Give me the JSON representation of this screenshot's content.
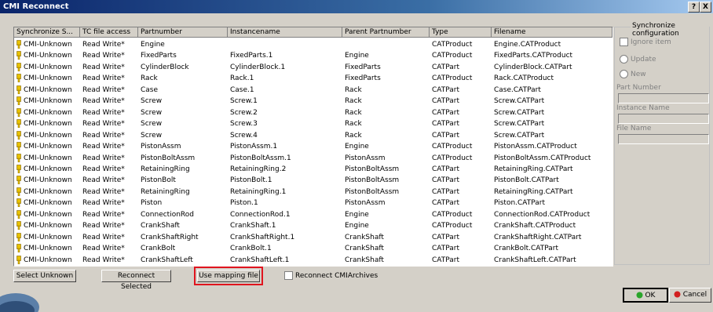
{
  "window": {
    "title": "CMI Reconnect",
    "help_label": "?",
    "close_label": "X"
  },
  "columns": [
    "Synchronize S...",
    "TC file access",
    "Partnumber",
    "Instancename",
    "Parent Partnumber",
    "Type",
    "Filename"
  ],
  "rows": [
    [
      "CMI-Unknown",
      "Read Write*",
      "Engine",
      "",
      "",
      "CATProduct",
      "Engine.CATProduct"
    ],
    [
      "CMI-Unknown",
      "Read Write*",
      "FixedParts",
      "FixedParts.1",
      "Engine",
      "CATProduct",
      "FixedParts.CATProduct"
    ],
    [
      "CMI-Unknown",
      "Read Write*",
      "CylinderBlock",
      "CylinderBlock.1",
      "FixedParts",
      "CATPart",
      "CylinderBlock.CATPart"
    ],
    [
      "CMI-Unknown",
      "Read Write*",
      "Rack",
      "Rack.1",
      "FixedParts",
      "CATProduct",
      "Rack.CATProduct"
    ],
    [
      "CMI-Unknown",
      "Read Write*",
      "Case",
      "Case.1",
      "Rack",
      "CATPart",
      "Case.CATPart"
    ],
    [
      "CMI-Unknown",
      "Read Write*",
      "Screw",
      "Screw.1",
      "Rack",
      "CATPart",
      "Screw.CATPart"
    ],
    [
      "CMI-Unknown",
      "Read Write*",
      "Screw",
      "Screw.2",
      "Rack",
      "CATPart",
      "Screw.CATPart"
    ],
    [
      "CMI-Unknown",
      "Read Write*",
      "Screw",
      "Screw.3",
      "Rack",
      "CATPart",
      "Screw.CATPart"
    ],
    [
      "CMI-Unknown",
      "Read Write*",
      "Screw",
      "Screw.4",
      "Rack",
      "CATPart",
      "Screw.CATPart"
    ],
    [
      "CMI-Unknown",
      "Read Write*",
      "PistonAssm",
      "PistonAssm.1",
      "Engine",
      "CATProduct",
      "PistonAssm.CATProduct"
    ],
    [
      "CMI-Unknown",
      "Read Write*",
      "PistonBoltAssm",
      "PistonBoltAssm.1",
      "PistonAssm",
      "CATProduct",
      "PistonBoltAssm.CATProduct"
    ],
    [
      "CMI-Unknown",
      "Read Write*",
      "RetainingRing",
      "RetainingRing.2",
      "PistonBoltAssm",
      "CATPart",
      "RetainingRing.CATPart"
    ],
    [
      "CMI-Unknown",
      "Read Write*",
      "PistonBolt",
      "PistonBolt.1",
      "PistonBoltAssm",
      "CATPart",
      "PistonBolt.CATPart"
    ],
    [
      "CMI-Unknown",
      "Read Write*",
      "RetainingRing",
      "RetainingRing.1",
      "PistonBoltAssm",
      "CATPart",
      "RetainingRing.CATPart"
    ],
    [
      "CMI-Unknown",
      "Read Write*",
      "Piston",
      "Piston.1",
      "PistonAssm",
      "CATPart",
      "Piston.CATPart"
    ],
    [
      "CMI-Unknown",
      "Read Write*",
      "ConnectionRod",
      "ConnectionRod.1",
      "Engine",
      "CATProduct",
      "ConnectionRod.CATProduct"
    ],
    [
      "CMI-Unknown",
      "Read Write*",
      "CrankShaft",
      "CrankShaft.1",
      "Engine",
      "CATProduct",
      "CrankShaft.CATProduct"
    ],
    [
      "CMI-Unknown",
      "Read Write*",
      "CrankShaftRight",
      "CrankShaftRight.1",
      "CrankShaft",
      "CATPart",
      "CrankShaftRight.CATPart"
    ],
    [
      "CMI-Unknown",
      "Read Write*",
      "CrankBolt",
      "CrankBolt.1",
      "CrankShaft",
      "CATPart",
      "CrankBolt.CATPart"
    ],
    [
      "CMI-Unknown",
      "Read Write*",
      "CrankShaftLeft",
      "CrankShaftLeft.1",
      "CrankShaft",
      "CATPart",
      "CrankShaftLeft.CATPart"
    ]
  ],
  "sync_panel": {
    "title": "Synchronize configuration",
    "ignore_item": "Ignore item",
    "update": "Update",
    "new": "New",
    "part_number": "Part Number",
    "instance_name": "Instance Name",
    "file_name": "File Name"
  },
  "buttons": {
    "select_unknown": "Select Unknown",
    "reconnect_selected": "Reconnect Selected",
    "use_mapping_file": "Use mapping file",
    "reconnect_archives": "Reconnect CMIArchives",
    "ok": "OK",
    "cancel": "Cancel"
  },
  "colors": {
    "title_start": "#0a246a",
    "highlight": "#e0141e",
    "lock_icon": "#e8c200",
    "ok_icon": "#2aa52a",
    "cancel_icon": "#d21e1e"
  }
}
